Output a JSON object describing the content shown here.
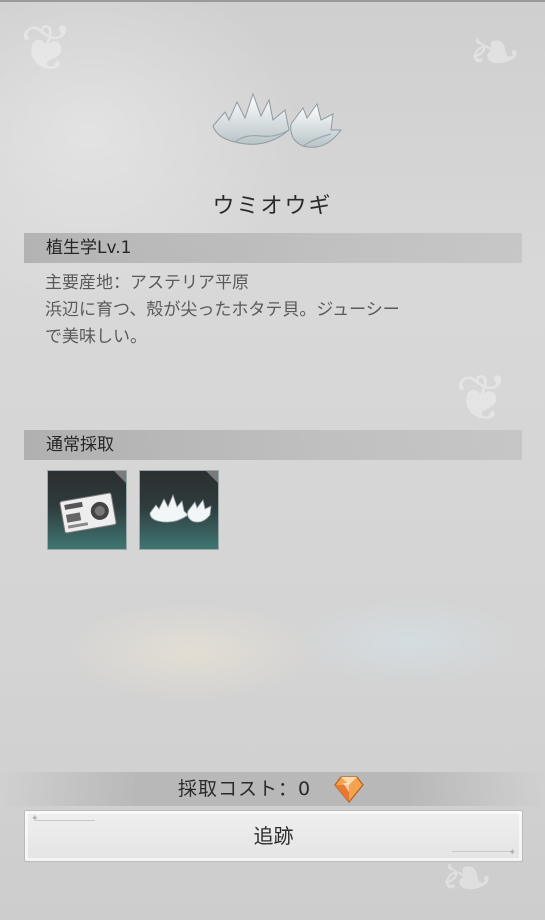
{
  "item": {
    "name": "ウミオウギ",
    "icon": "white-scallop-shell-icon"
  },
  "sections": {
    "skill": {
      "label": "植生学Lv.1",
      "description": [
        "主要産地：アステリア平原",
        "浜辺に育つ、殻が尖ったホタテ貝。ジューシー",
        "で美味しい。"
      ]
    },
    "gathering": {
      "label": "通常採取",
      "slots": [
        {
          "icon": "ticket-card-icon"
        },
        {
          "icon": "white-scallop-shell-icon"
        }
      ]
    }
  },
  "cost": {
    "label": "採取コスト：0",
    "icon": "orange-crystal-icon"
  },
  "track_button": {
    "label": "追跡"
  },
  "colors": {
    "panel": "#d6d6d6",
    "section_bar": "#9a9a9a",
    "slot_top": "#2b2f30",
    "slot_bottom": "#3f7672",
    "crystal": "#f08a3c"
  }
}
